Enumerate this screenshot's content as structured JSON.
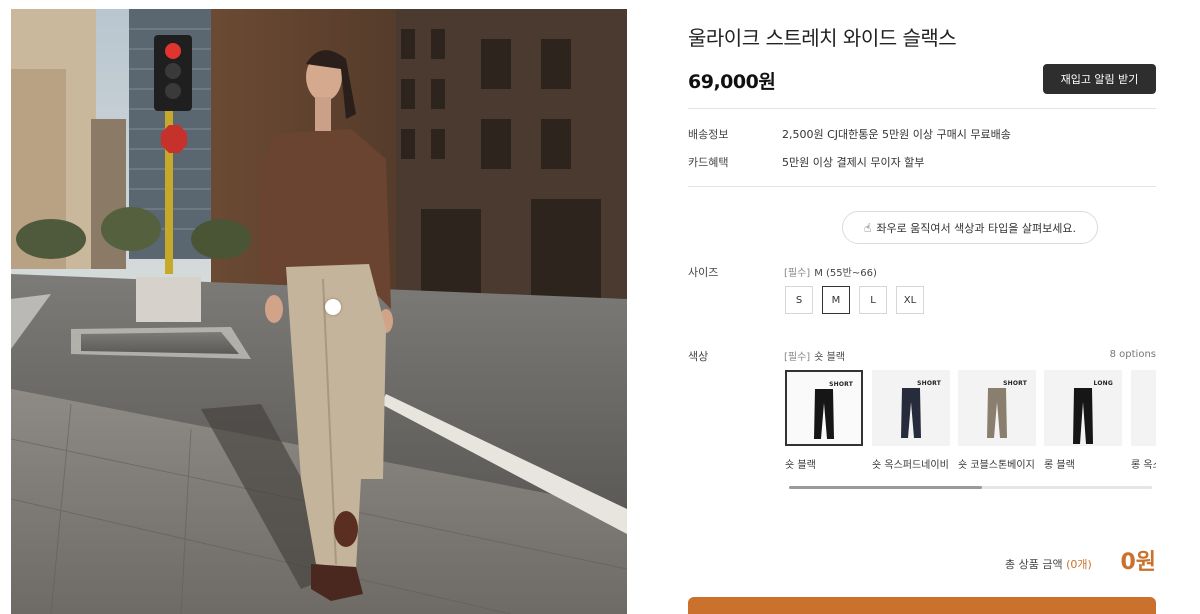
{
  "product": {
    "title": "울라이크 스트레치 와이드 슬랙스",
    "price": "69,000원",
    "restock_label": "재입고 알림 받기"
  },
  "shipping": {
    "label": "배송정보",
    "value": "2,500원  CJ대한통운 5만원 이상 구매시 무료배송"
  },
  "card": {
    "label": "카드혜택",
    "value": "5만원 이상 결제시 무이자 할부"
  },
  "hint": {
    "icon": "hand-pointer-icon",
    "text": "좌우로 움직여서 색상과 타입을 살펴보세요."
  },
  "size": {
    "label": "사이즈",
    "required": "[필수]",
    "selected": "M (55반~66)",
    "options": [
      "S",
      "M",
      "L",
      "XL"
    ]
  },
  "color": {
    "label": "색상",
    "required": "[필수]",
    "selected": "숏 블랙",
    "count": "8 options",
    "swatches": [
      {
        "tag": "SHORT",
        "name": "숏 블랙",
        "pants_color": "#161616"
      },
      {
        "tag": "SHORT",
        "name": "숏 옥스퍼드네이비",
        "pants_color": "#262c3b"
      },
      {
        "tag": "SHORT",
        "name": "숏 코블스톤베이지",
        "pants_color": "#8a7f6f"
      },
      {
        "tag": "LONG",
        "name": "롱 블랙",
        "pants_color": "#161616"
      },
      {
        "tag": "",
        "name": "롱 옥스",
        "pants_color": "#262c3b"
      }
    ],
    "scroll_position": 0.53
  },
  "total": {
    "label": "총 상품 금액",
    "count": "(0개)",
    "value": "0원"
  },
  "colors": {
    "accent": "#c9712d",
    "dark_button": "#2e2e2e"
  }
}
